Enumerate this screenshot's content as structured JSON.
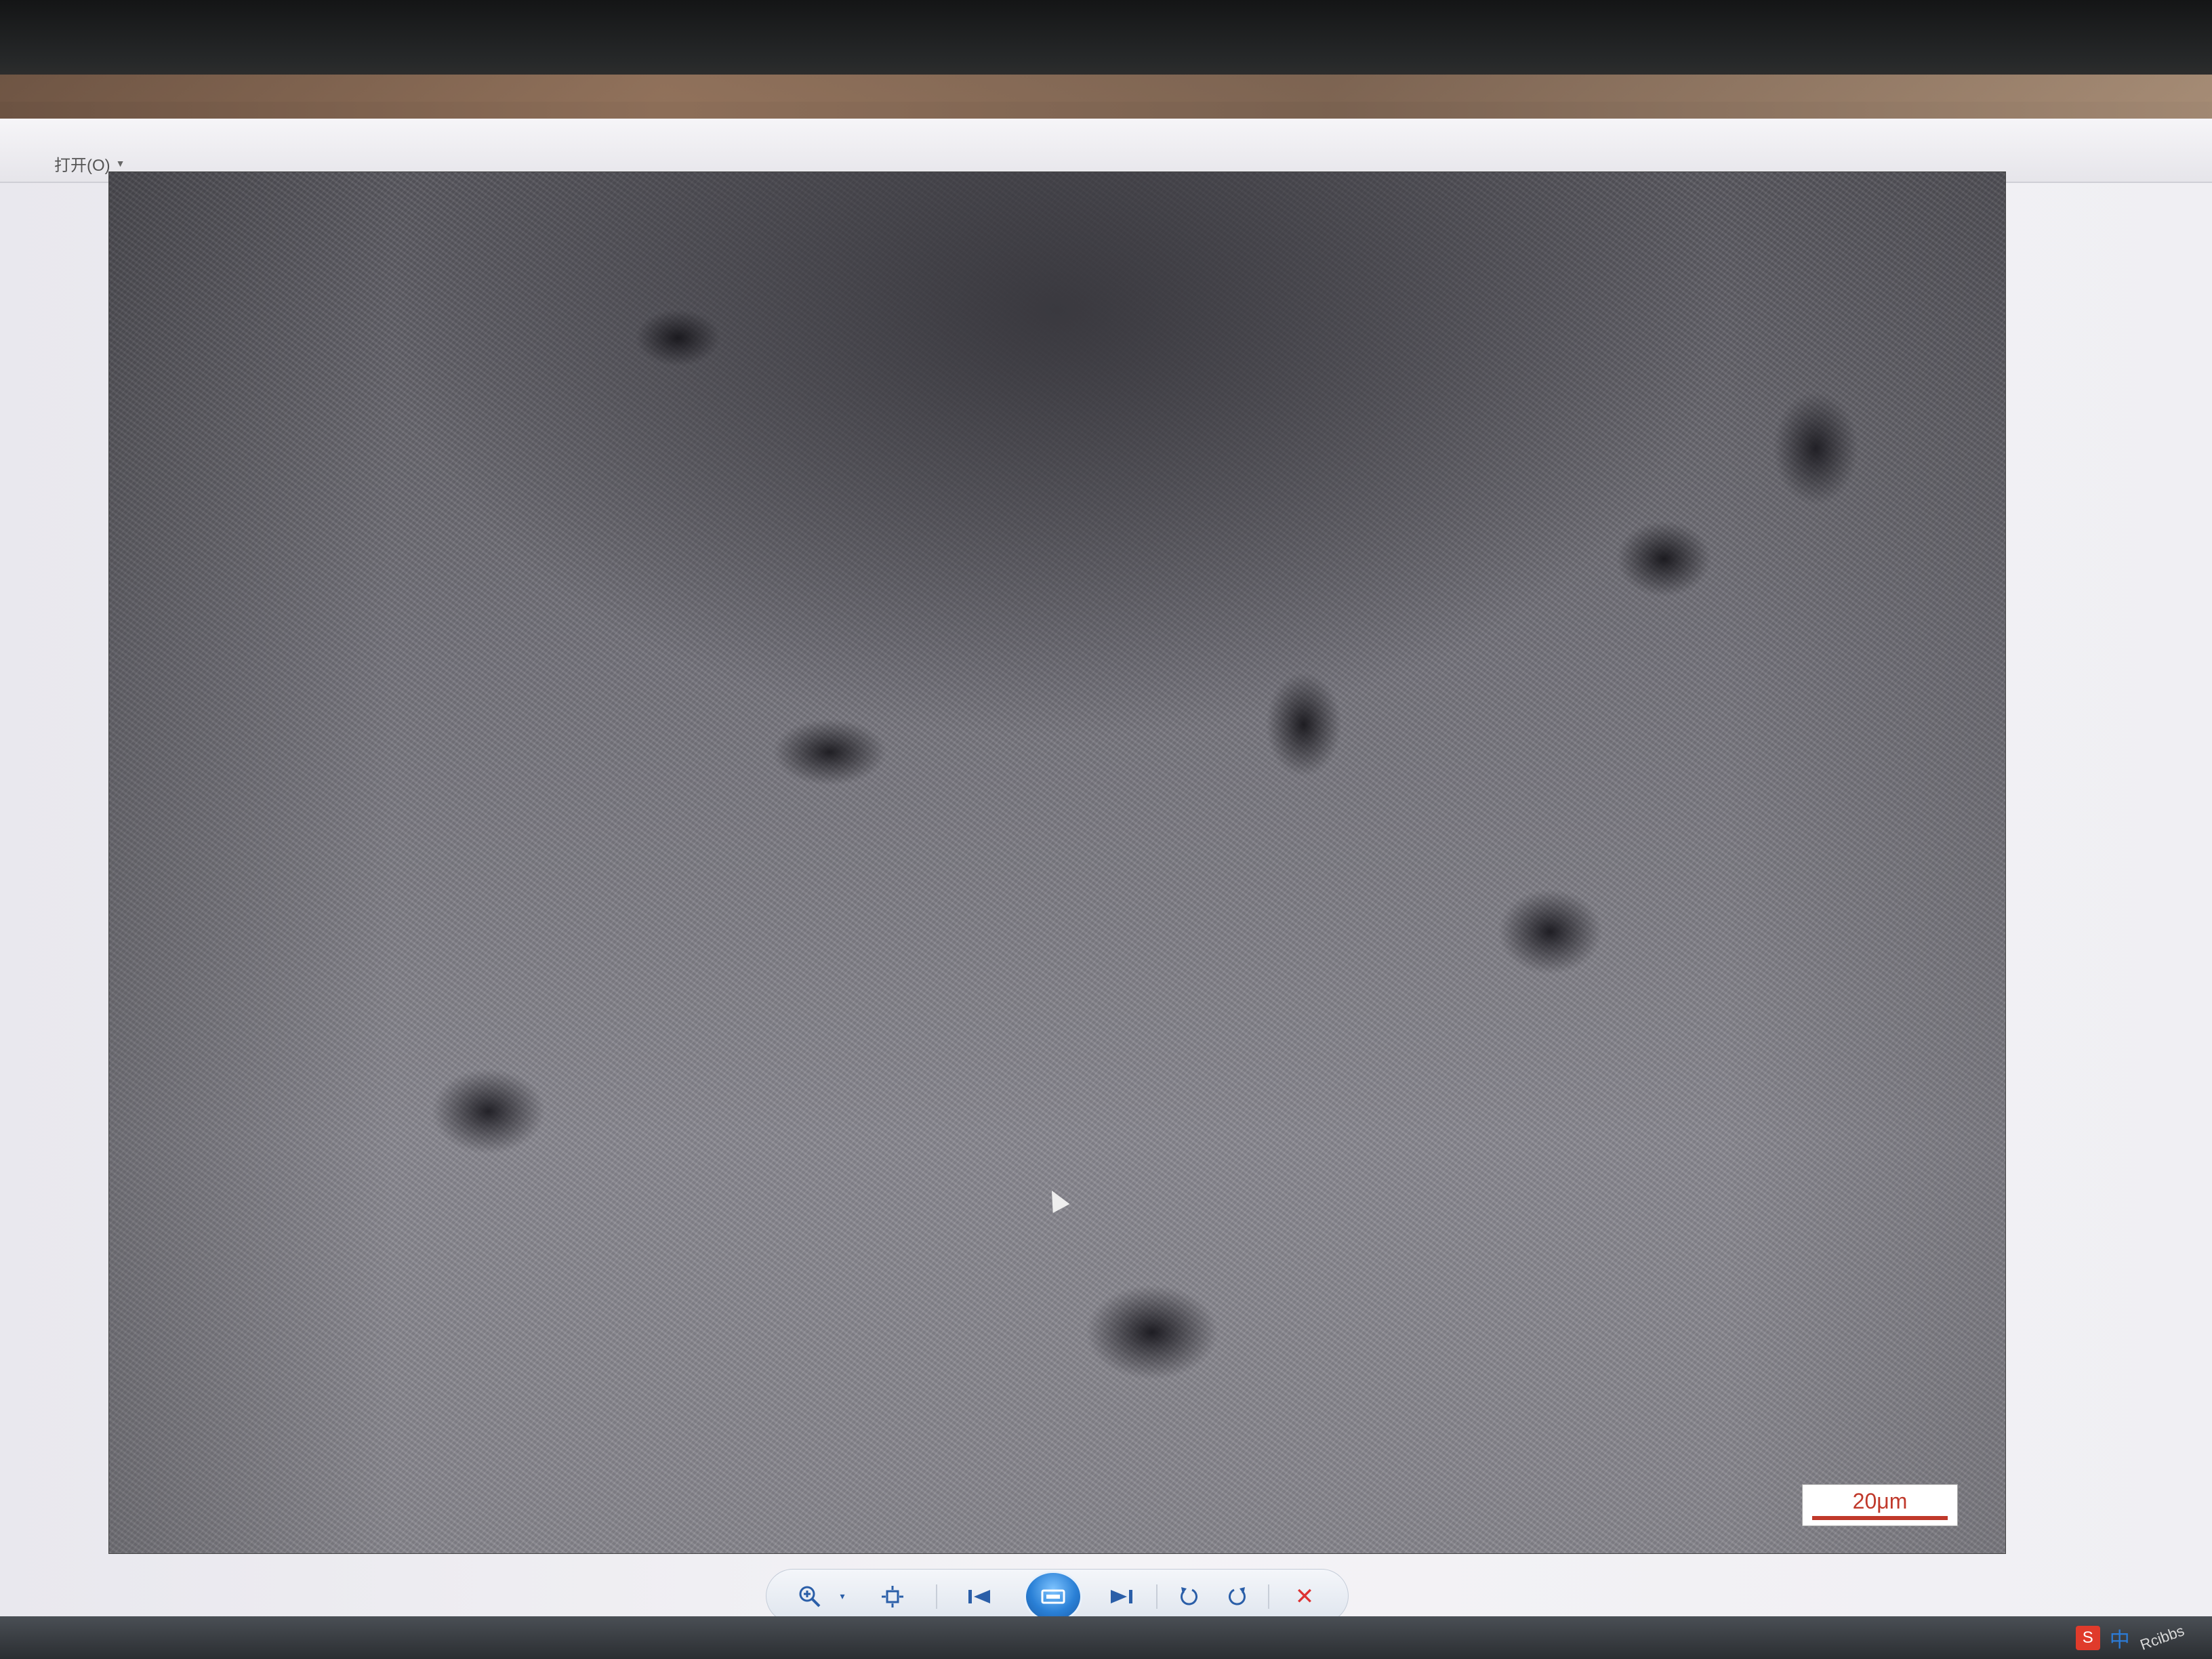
{
  "menu": {
    "items": [
      {
        "label": "打开(O)"
      }
    ]
  },
  "image_viewer": {
    "scale_bar_label": "20μm"
  },
  "toolbar": {
    "zoom": "zoom-icon",
    "fit": "fit-window-icon",
    "previous": "previous-icon",
    "slideshow": "slideshow-icon",
    "next": "next-icon",
    "rotate_ccw": "rotate-left-icon",
    "rotate_cw": "rotate-right-icon",
    "delete": "delete-icon"
  },
  "taskbar": {
    "ime_logo": "S",
    "ime_mode": "中",
    "watermark": "Rcibbs"
  }
}
